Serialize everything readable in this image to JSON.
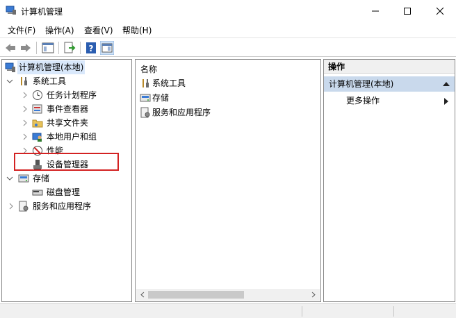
{
  "window": {
    "title": "计算机管理",
    "app_icon": "computer-management-icon"
  },
  "window_controls": {
    "minimize_icon": "minimize-icon",
    "maximize_icon": "maximize-icon",
    "close_icon": "close-icon"
  },
  "menu": [
    "文件(F)",
    "操作(A)",
    "查看(V)",
    "帮助(H)"
  ],
  "toolbar": [
    "back-arrow-icon",
    "forward-arrow-icon",
    "show-hide-console-tree-icon",
    "export-list-icon",
    "help-icon",
    "show-hide-action-pane-icon"
  ],
  "tree": {
    "root": "计算机管理(本地)",
    "system_tools": "系统工具",
    "task_scheduler": "任务计划程序",
    "event_viewer": "事件查看器",
    "shared_folders": "共享文件夹",
    "local_users_groups": "本地用户和组",
    "performance": "性能",
    "device_manager": "设备管理器",
    "storage": "存储",
    "disk_management": "磁盘管理",
    "services_apps": "服务和应用程序"
  },
  "middle": {
    "column_header": "名称",
    "items": [
      "系统工具",
      "存储",
      "服务和应用程序"
    ]
  },
  "actions": {
    "header": "操作",
    "section": "计算机管理(本地)",
    "more": "更多操作"
  },
  "colors": {
    "selection": "#d9e8fb",
    "highlight_box": "#d32222",
    "action_section": "#c9d9ec"
  }
}
